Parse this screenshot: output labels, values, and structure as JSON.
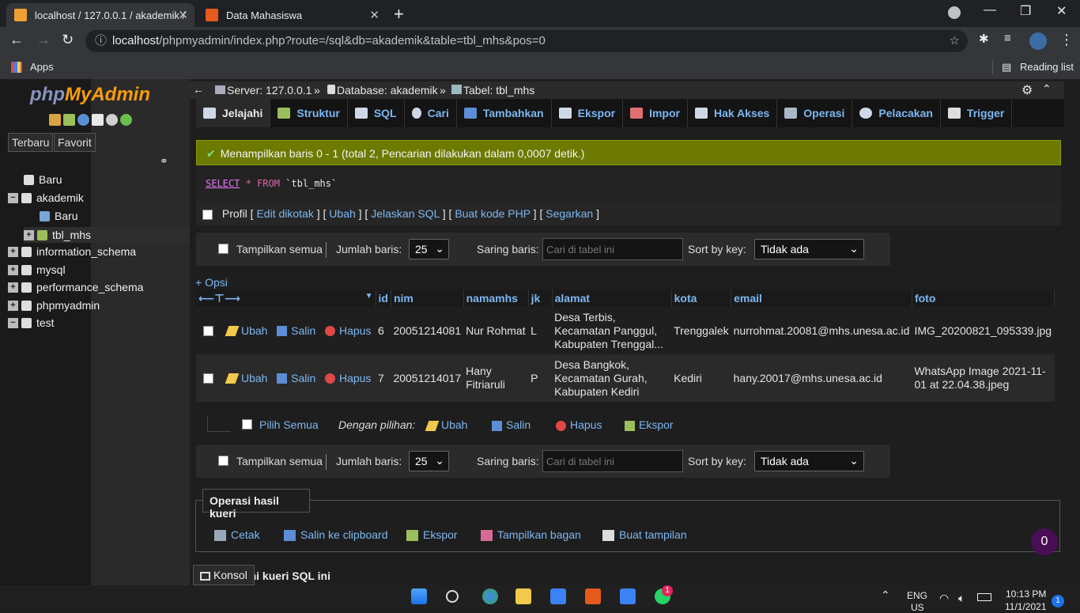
{
  "browser": {
    "tabs": [
      {
        "label": "localhost / 127.0.0.1 / akademik /",
        "active": true
      },
      {
        "label": "Data Mahasiswa",
        "active": false
      }
    ],
    "url_host": "localhost",
    "url_path": "/phpmyadmin/index.php?route=/sql&db=akademik&table=tbl_mhs&pos=0",
    "bookmarks_apps": "Apps",
    "reading_list": "Reading list"
  },
  "pma": {
    "logo_php": "php",
    "logo_myadmin": "MyAdmin",
    "sidebar_tabs": [
      "Terbaru",
      "Favorit"
    ],
    "tree": [
      "Baru",
      "akademik",
      "Baru",
      "tbl_mhs",
      "information_schema",
      "mysql",
      "performance_schema",
      "phpmyadmin",
      "test"
    ],
    "breadcrumb": {
      "server": "Server: 127.0.0.1",
      "database": "Database: akademik",
      "table": "Tabel: tbl_mhs",
      "sep": "»"
    },
    "nav": [
      "Jelajahi",
      "Struktur",
      "SQL",
      "Cari",
      "Tambahkan",
      "Ekspor",
      "Impor",
      "Hak Akses",
      "Operasi",
      "Pelacakan",
      "Trigger"
    ],
    "success_msg": "Menampilkan baris 0 - 1 (total 2, Pencarian dilakukan dalam 0,0007 detik.)",
    "sql": {
      "kw": "SELECT",
      "star": "*",
      "from": "FROM",
      "table": "`tbl_mhs`"
    },
    "profile": {
      "label": "Profil",
      "links": [
        "Edit dikotak",
        "Ubah",
        "Jelaskan SQL",
        "Buat kode PHP",
        "Segarkan"
      ]
    },
    "navbar": {
      "show_all": "Tampilkan semua",
      "rows_label": "Jumlah baris:",
      "rows_value": "25",
      "filter_label": "Saring baris:",
      "filter_placeholder": "Cari di tabel ini",
      "sort_label": "Sort by key:",
      "sort_value": "Tidak ada"
    },
    "opsi": "+ Opsi",
    "columns": [
      "id",
      "nim",
      "namamhs",
      "jk",
      "alamat",
      "kota",
      "email",
      "foto"
    ],
    "row_actions": {
      "edit": "Ubah",
      "copy": "Salin",
      "delete": "Hapus"
    },
    "rows": [
      {
        "id": "6",
        "nim": "20051214081",
        "namamhs": "Nur Rohmat",
        "jk": "L",
        "alamat": "Desa Terbis, Kecamatan Panggul, Kabupaten Trenggal...",
        "kota": "Trenggalek",
        "email": "nurrohmat.20081@mhs.unesa.ac.id",
        "foto": "IMG_20200821_095339.jpg"
      },
      {
        "id": "7",
        "nim": "20051214017",
        "namamhs": "Hany Fitriaruli",
        "jk": "P",
        "alamat": "Desa Bangkok, Kecamatan Gurah, Kabupaten Kediri",
        "kota": "Kediri",
        "email": "hany.20017@mhs.unesa.ac.id",
        "foto": "WhatsApp Image 2021-11-01 at 22.04.38.jpeg"
      }
    ],
    "bulk": {
      "select_all": "Pilih Semua",
      "with_selected": "Dengan pilihan:",
      "edit": "Ubah",
      "copy": "Salin",
      "delete": "Hapus",
      "export": "Ekspor"
    },
    "ops": {
      "legend": "Operasi hasil kueri",
      "items": [
        "Cetak",
        "Salin ke clipboard",
        "Ekspor",
        "Tampilkan bagan",
        "Buat tampilan"
      ]
    },
    "console": "Konsol",
    "bookmark_partial": "kahi kueri SQL ini",
    "badge": "0"
  },
  "taskbar": {
    "lang": "ENG",
    "lang2": "US",
    "time": "10:13 PM",
    "date": "11/1/2021",
    "notif": "1",
    "wa_badge": "1"
  }
}
